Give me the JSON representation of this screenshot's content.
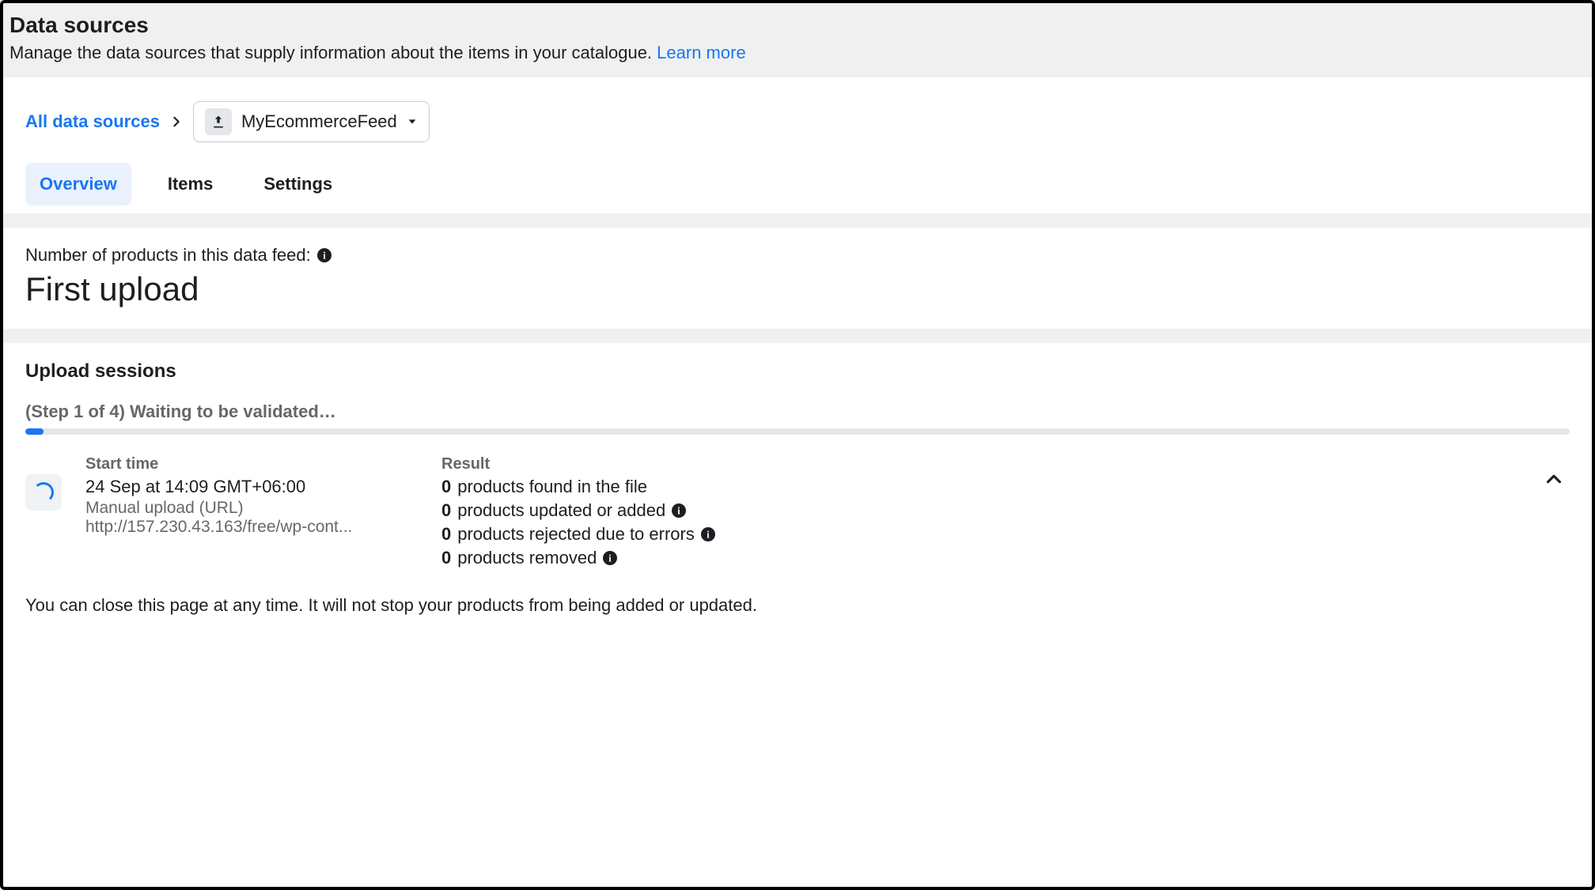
{
  "header": {
    "title": "Data sources",
    "subtitle": "Manage the data sources that supply information about the items in your catalogue.",
    "learn_more": "Learn more"
  },
  "breadcrumb": {
    "all_link": "All data sources",
    "feed_name": "MyEcommerceFeed"
  },
  "tabs": [
    {
      "label": "Overview",
      "active": true
    },
    {
      "label": "Items",
      "active": false
    },
    {
      "label": "Settings",
      "active": false
    }
  ],
  "feed_info": {
    "count_label": "Number of products in this data feed:",
    "status_title": "First upload"
  },
  "upload_sessions": {
    "title": "Upload sessions",
    "step_label": "(Step 1 of 4) Waiting to be validated…",
    "progress_percent": 1.2,
    "session": {
      "start_label": "Start time",
      "start_time": "24 Sep at 14:09 GMT+06:00",
      "method": "Manual upload (URL)",
      "url": "http://157.230.43.163/free/wp-cont...",
      "result_label": "Result",
      "results": [
        {
          "count": "0",
          "text": "products found in the file",
          "info": false
        },
        {
          "count": "0",
          "text": "products updated or added",
          "info": true
        },
        {
          "count": "0",
          "text": "products rejected due to errors",
          "info": true
        },
        {
          "count": "0",
          "text": "products removed",
          "info": true
        }
      ]
    },
    "note": "You can close this page at any time. It will not stop your products from being added or updated."
  }
}
